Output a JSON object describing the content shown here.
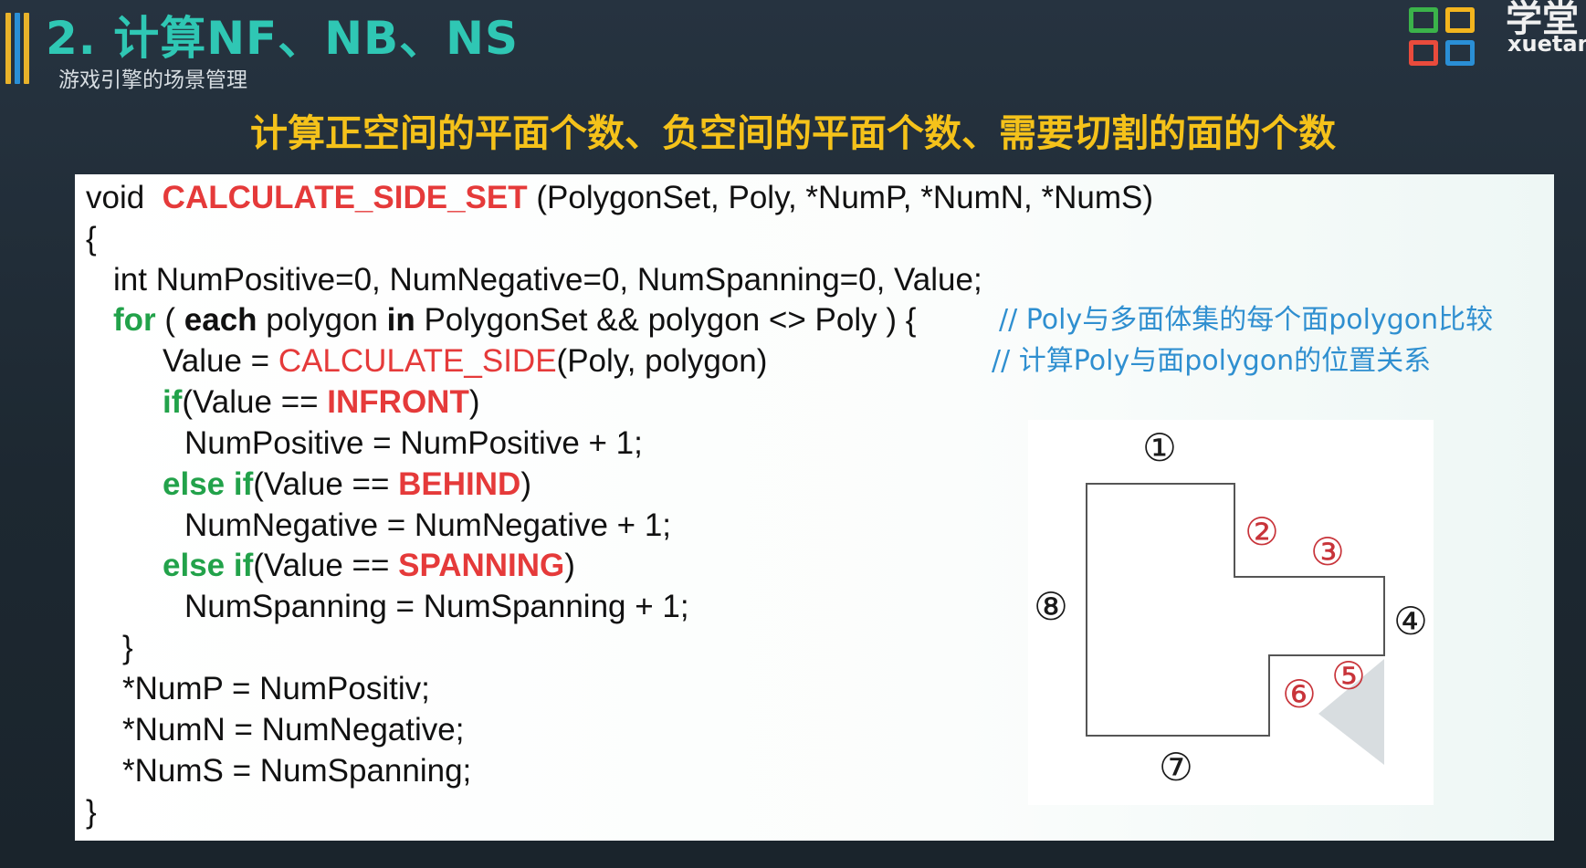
{
  "slide": {
    "title": "2. 计算NF、NB、NS",
    "subtitle": "游戏引擎的场景管理",
    "heading": "计算正空间的平面个数、负空间的平面个数、需要切割的面的个数",
    "logo_text_top": "学堂",
    "logo_text_bottom": "xuetang",
    "accent_bar_colors": [
      "#e8b22a",
      "#2a8fd6",
      "#e8b22a"
    ],
    "logo_colors": [
      "#3bb34a",
      "#f3b51e",
      "#e94b3c",
      "#2a8fd6"
    ]
  },
  "code": {
    "l1_void": "void",
    "l1_fn": "CALCULATE_SIDE_SET",
    "l1_args": "(PolygonSet, Poly, *NumP, *NumN, *NumS)",
    "l2_open": "{",
    "l3_decl": "int NumPositive=0, NumNegative=0, NumSpanning=0, Value;",
    "l4_for": "for",
    "l4_paren": " ( ",
    "l4_each": "each",
    "l4_polygon": " polygon ",
    "l4_in": "in",
    "l4_rest": " PolygonSet && polygon <> Poly ) {",
    "l4_comment": "// Poly与多面体集的每个面polygon比较",
    "l5_value": "Value = ",
    "l5_fn": "CALCULATE_SIDE",
    "l5_args": "(Poly, polygon)",
    "l5_comment": "// 计算Poly与面polygon的位置关系",
    "l6_if": "if",
    "l6_pre": "(Value == ",
    "l6_const": "INFRONT",
    "l6_post": ")",
    "l7_stmt": "NumPositive = NumPositive + 1;",
    "l8_else": "else if",
    "l8_pre": "(Value == ",
    "l8_const": "BEHIND",
    "l8_post": ")",
    "l9_stmt": "NumNegative = NumNegative + 1;",
    "l10_else": "else if",
    "l10_pre": "(Value == ",
    "l10_const": "SPANNING",
    "l10_post": ")",
    "l11_stmt": "NumSpanning = NumSpanning + 1;",
    "l12_close": "}",
    "l13_stmt": "*NumP = NumPositiv;",
    "l14_stmt": "*NumN = NumNegative;",
    "l15_stmt": "*NumS = NumSpanning;",
    "l16_close": "}"
  },
  "figure": {
    "labels": [
      "①",
      "②",
      "③",
      "④",
      "⑤",
      "⑥",
      "⑦",
      "⑧"
    ],
    "label_colors": {
      "black": "#1a1a1a",
      "red": "#c8343a"
    }
  }
}
